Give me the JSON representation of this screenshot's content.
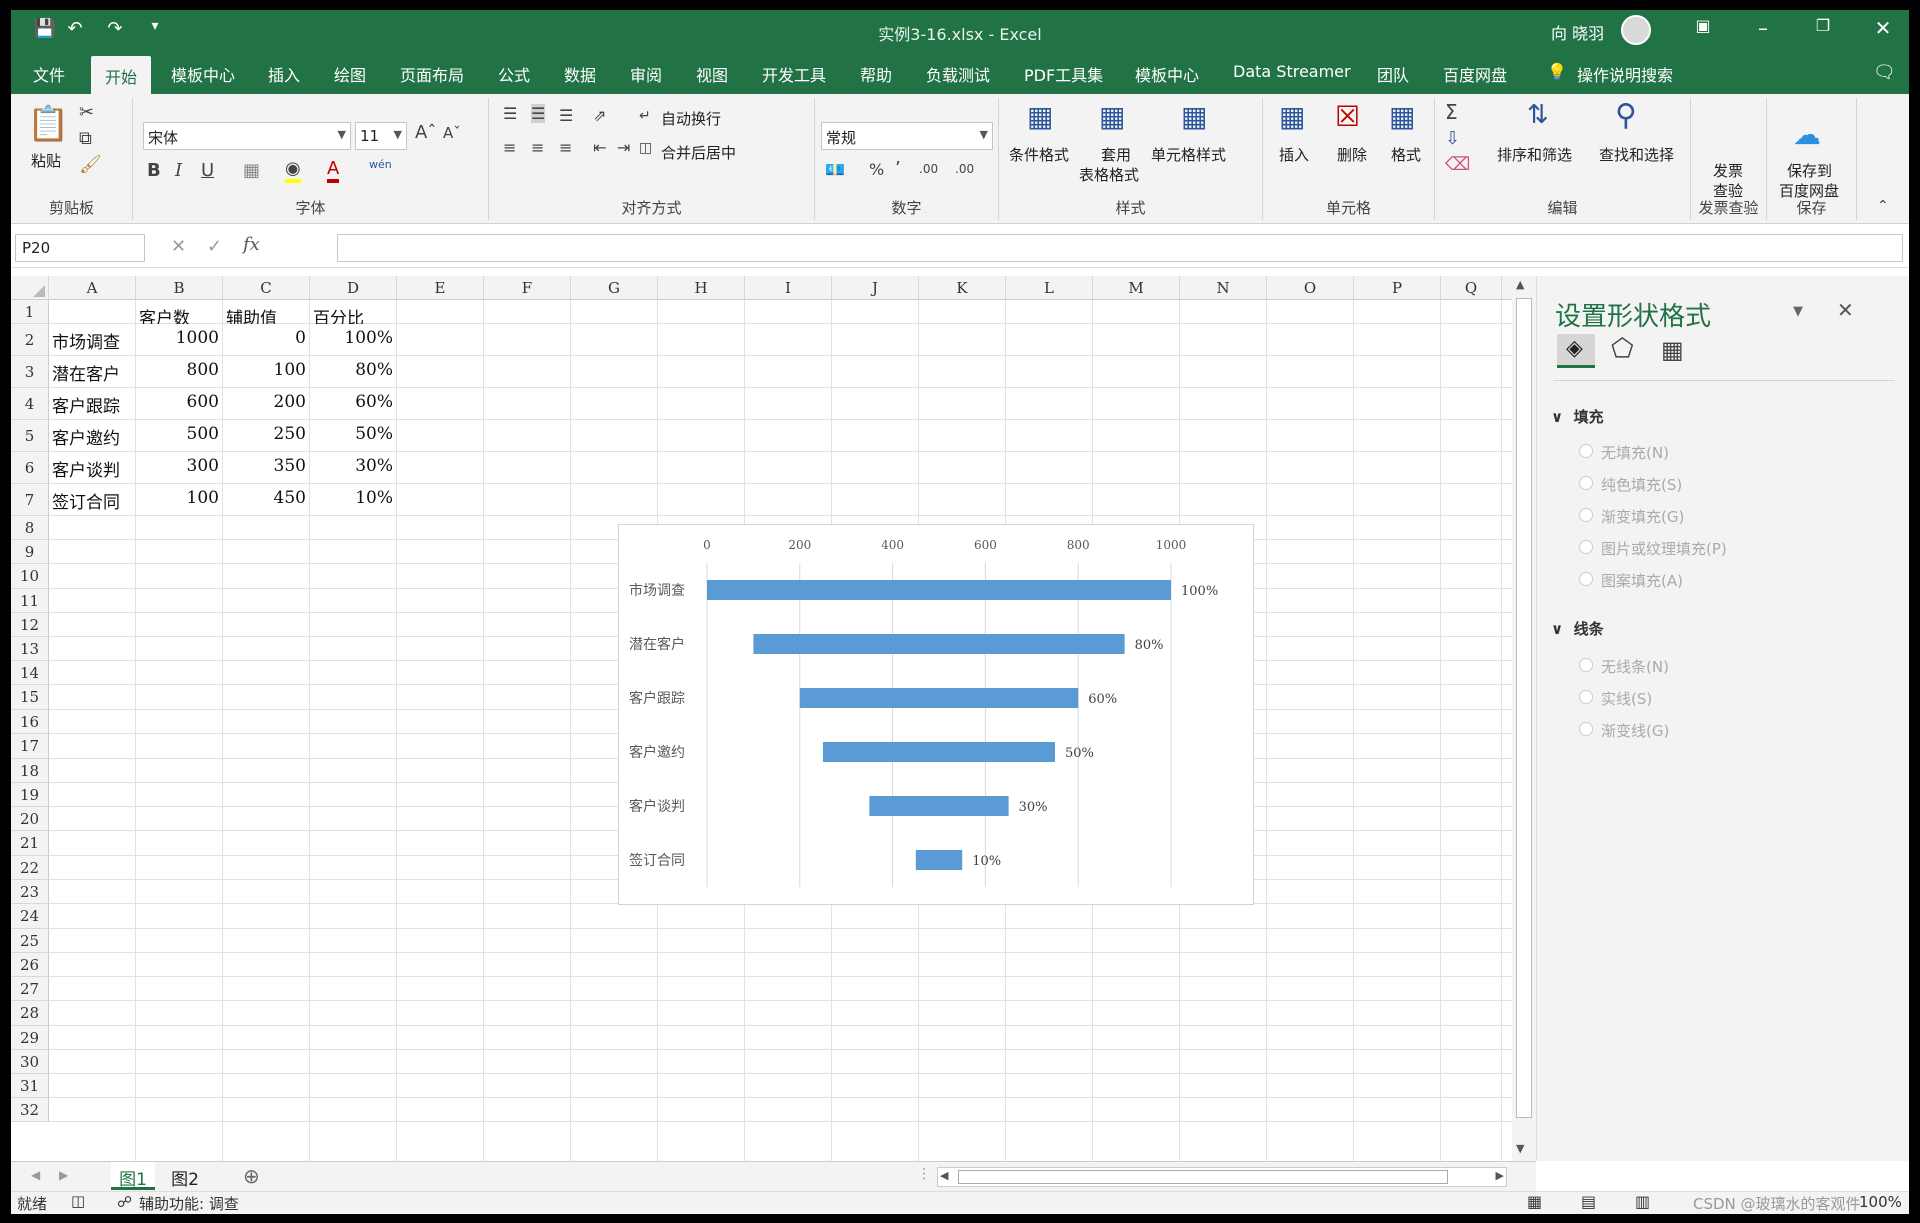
{
  "window": {
    "title": "实例3-16.xlsx  -  Excel",
    "user": "向 晓羽"
  },
  "menu_tabs": [
    "文件",
    "开始",
    "模板中心",
    "插入",
    "绘图",
    "页面布局",
    "公式",
    "数据",
    "审阅",
    "视图",
    "开发工具",
    "帮助",
    "负载测试",
    "PDF工具集",
    "模板中心",
    "Data Streamer",
    "团队",
    "百度网盘"
  ],
  "tell_me": "操作说明搜索",
  "ribbon": {
    "clipboard": {
      "label": "剪贴板",
      "paste": "粘贴"
    },
    "font": {
      "label": "字体",
      "font_name": "宋体",
      "font_size": "11",
      "wen": "wén"
    },
    "alignment": {
      "label": "对齐方式",
      "wrap": "自动换行",
      "merge": "合并后居中"
    },
    "number": {
      "label": "数字",
      "format": "常规"
    },
    "styles": {
      "label": "样式",
      "cond": "条件格式",
      "table1": "套用",
      "table2": "表格格式",
      "cell": "单元格样式"
    },
    "cells": {
      "label": "单元格",
      "insert": "插入",
      "delete": "删除",
      "format": "格式"
    },
    "editing": {
      "label": "编辑",
      "sort": "排序和筛选",
      "find": "查找和选择"
    },
    "invoice": {
      "label": "发票查验",
      "line1": "发票",
      "line2": "查验"
    },
    "save": {
      "label": "保存",
      "line1": "保存到",
      "line2": "百度网盘"
    }
  },
  "formula_bar": {
    "name_box": "P20",
    "formula": ""
  },
  "columns": [
    "A",
    "B",
    "C",
    "D",
    "E",
    "F",
    "G",
    "H",
    "I",
    "J",
    "K",
    "L",
    "M",
    "N",
    "O",
    "P",
    "Q"
  ],
  "rows": [
    "1",
    "2",
    "3",
    "4",
    "5",
    "6",
    "7",
    "8",
    "9",
    "10",
    "11",
    "12",
    "13",
    "14",
    "15",
    "16",
    "17",
    "18",
    "19",
    "20",
    "21",
    "22",
    "23",
    "24",
    "25",
    "26",
    "27",
    "28",
    "29",
    "30",
    "31",
    "32"
  ],
  "table": {
    "headers": [
      "",
      "客户数",
      "辅助值",
      "百分比"
    ],
    "rows": [
      [
        "市场调查",
        "1000",
        "0",
        "100%"
      ],
      [
        "潜在客户",
        "800",
        "100",
        "80%"
      ],
      [
        "客户跟踪",
        "600",
        "200",
        "60%"
      ],
      [
        "客户邀约",
        "500",
        "250",
        "50%"
      ],
      [
        "客户谈判",
        "300",
        "350",
        "30%"
      ],
      [
        "签订合同",
        "100",
        "450",
        "10%"
      ]
    ]
  },
  "chart_data": {
    "type": "bar",
    "categories": [
      "市场调查",
      "潜在客户",
      "客户跟踪",
      "客户邀约",
      "客户谈判",
      "签订合同"
    ],
    "series": [
      {
        "name": "辅助值",
        "values": [
          0,
          100,
          200,
          250,
          350,
          450
        ],
        "color": "transparent"
      },
      {
        "name": "客户数",
        "values": [
          1000,
          800,
          600,
          500,
          300,
          100
        ],
        "color": "#5b9bd5"
      }
    ],
    "data_labels": [
      "100%",
      "80%",
      "60%",
      "50%",
      "30%",
      "10%"
    ],
    "xlim": [
      0,
      1000
    ],
    "x_ticks": [
      "0",
      "200",
      "400",
      "600",
      "800",
      "1000"
    ],
    "axis_position": "top",
    "grid": true,
    "stacked": true
  },
  "format_pane": {
    "title": "设置形状格式",
    "fill_section": "填充",
    "fill_options": [
      "无填充(N)",
      "纯色填充(S)",
      "渐变填充(G)",
      "图片或纹理填充(P)",
      "图案填充(A)"
    ],
    "line_section": "线条",
    "line_options": [
      "无线条(N)",
      "实线(S)",
      "渐变线(G)"
    ]
  },
  "sheet_tabs": [
    "图1",
    "图2"
  ],
  "status": {
    "ready": "就绪",
    "accessibility": "辅助功能: 调查",
    "zoom": "100%",
    "watermark": "CSDN @玻璃水的客观件"
  }
}
